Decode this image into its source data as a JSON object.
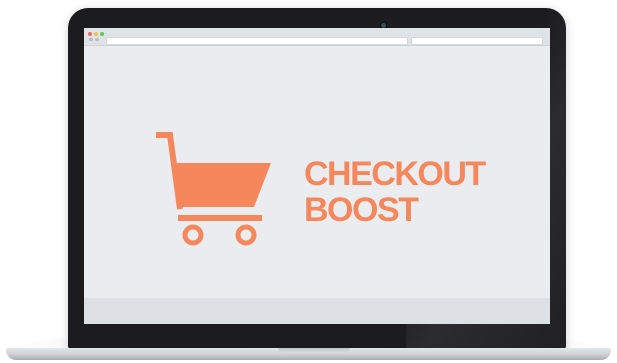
{
  "brand": {
    "line1": "CHECKOUT",
    "line2": "BOOST",
    "color": "#f5875c"
  },
  "icons": {
    "logo": "shopping-cart-icon",
    "camera": "webcam-icon"
  },
  "colors": {
    "bezel": "#1c1c1e",
    "screen_background": "#eaecef",
    "accent": "#f5875c"
  }
}
